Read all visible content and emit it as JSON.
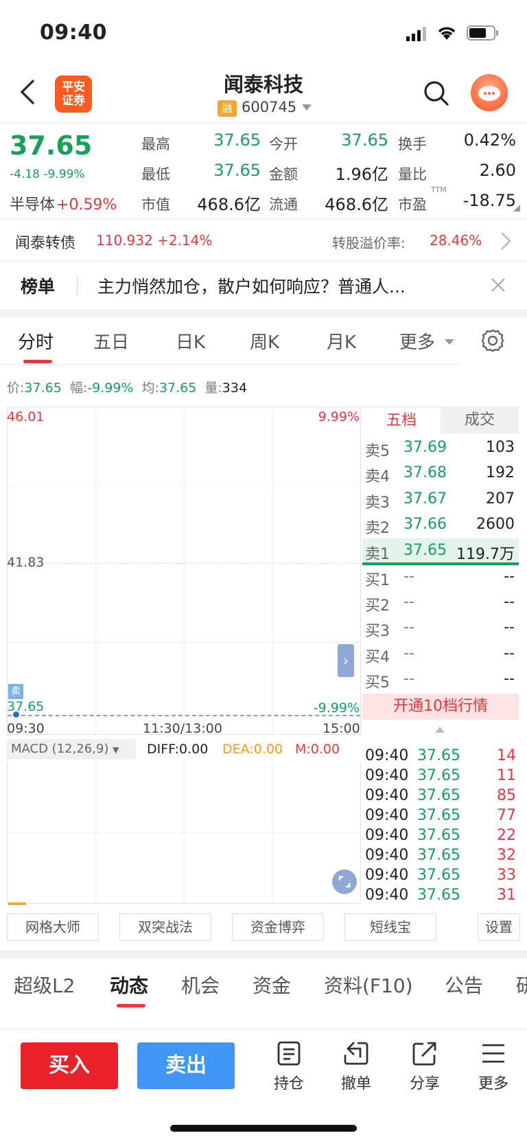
{
  "status_bar": {
    "time": "09:40"
  },
  "header": {
    "broker_logo_line1": "平安",
    "broker_logo_line2": "证券",
    "stock_name": "闻泰科技",
    "rong_badge": "融",
    "stock_code": "600745"
  },
  "quote": {
    "price": "37.65",
    "change": "-4.18",
    "change_pct": "-9.99%",
    "sector_name": "半导体",
    "sector_change": "+0.59%",
    "high_label": "最高",
    "high": "37.65",
    "open_label": "今开",
    "open": "37.65",
    "turnover_label": "换手",
    "turnover": "0.42%",
    "low_label": "最低",
    "low": "37.65",
    "amount_label": "金额",
    "amount": "1.96亿",
    "vol_ratio_label": "量比",
    "vol_ratio": "2.60",
    "mktcap_label": "市值",
    "mktcap": "468.6亿",
    "float_label": "流通",
    "float": "468.6亿",
    "pe_label": "市盈",
    "pe_sup": "TTM",
    "pe": "-18.75"
  },
  "convertible": {
    "name": "闻泰转债",
    "price": "110.932",
    "change": "+2.14%",
    "premium_label": "转股溢价率:",
    "premium": "28.46%"
  },
  "news": {
    "tag": "榜单",
    "text": "主力悄然加仓，散户如何响应？普通人..."
  },
  "chart_tabs": [
    "分时",
    "五日",
    "日K",
    "周K",
    "月K",
    "更多"
  ],
  "info_line": {
    "price_label": "价:",
    "price": "37.65",
    "range_label": "幅:",
    "range": "-9.99%",
    "avg_label": "均:",
    "avg": "37.65",
    "vol_label": "量:",
    "vol": "334"
  },
  "chart": {
    "y_top": "46.01",
    "y_mid": "41.83",
    "y_bottom": "37.65",
    "pct_top": "9.99%",
    "pct_bottom": "-9.99%",
    "sell_mark": "卖",
    "t_start": "09:30",
    "t_mid": "11:30/13:00",
    "t_end": "15:00"
  },
  "macd": {
    "label": "MACD (12,26,9)",
    "diff": "DIFF:0.00",
    "dea": "DEA:0.00",
    "m": "M:0.00"
  },
  "order_book": {
    "tab_levels": "五档",
    "tab_trades": "成交",
    "rows": [
      {
        "label": "卖5",
        "price": "37.69",
        "vol": "103"
      },
      {
        "label": "卖4",
        "price": "37.68",
        "vol": "192"
      },
      {
        "label": "卖3",
        "price": "37.67",
        "vol": "207"
      },
      {
        "label": "卖2",
        "price": "37.66",
        "vol": "2600"
      },
      {
        "label": "卖1",
        "price": "37.65",
        "vol": "119.7万"
      },
      {
        "label": "买1",
        "price": "--",
        "vol": "--"
      },
      {
        "label": "买2",
        "price": "--",
        "vol": "--"
      },
      {
        "label": "买3",
        "price": "--",
        "vol": "--"
      },
      {
        "label": "买4",
        "price": "--",
        "vol": "--"
      },
      {
        "label": "买5",
        "price": "--",
        "vol": "--"
      }
    ],
    "cta": "开通10档行情"
  },
  "trades": [
    {
      "time": "09:40",
      "price": "37.65",
      "vol": "14"
    },
    {
      "time": "09:40",
      "price": "37.65",
      "vol": "11"
    },
    {
      "time": "09:40",
      "price": "37.65",
      "vol": "85"
    },
    {
      "time": "09:40",
      "price": "37.65",
      "vol": "77"
    },
    {
      "time": "09:40",
      "price": "37.65",
      "vol": "22"
    },
    {
      "time": "09:40",
      "price": "37.65",
      "vol": "32"
    },
    {
      "time": "09:40",
      "price": "37.65",
      "vol": "33"
    },
    {
      "time": "09:40",
      "price": "37.65",
      "vol": "31"
    }
  ],
  "tools": [
    "网格大师",
    "双突战法",
    "资金博弈",
    "短线宝",
    "设置"
  ],
  "bottom_tabs": [
    "超级L2",
    "动态",
    "机会",
    "资金",
    "资料(F10)",
    "公告",
    "研"
  ],
  "actions": {
    "buy": "买入",
    "sell": "卖出",
    "holdings": "持仓",
    "cancel": "撤单",
    "share": "分享",
    "more": "更多"
  }
}
